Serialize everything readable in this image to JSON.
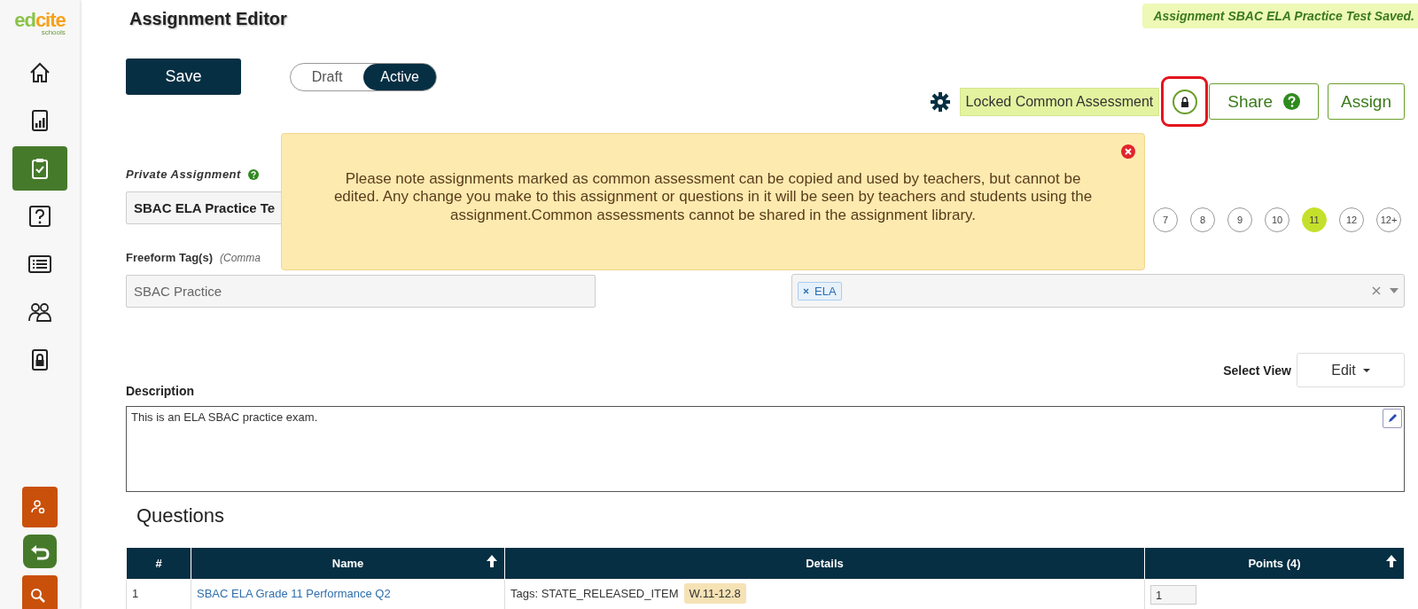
{
  "logo": {
    "brand": "edcite",
    "sub": "schools"
  },
  "sidebar": {
    "items": [
      {
        "kind": "home",
        "selected": false
      },
      {
        "kind": "reports",
        "selected": false
      },
      {
        "kind": "assignments",
        "selected": true
      },
      {
        "kind": "questions",
        "selected": false
      },
      {
        "kind": "lists",
        "selected": false
      },
      {
        "kind": "people",
        "selected": false
      },
      {
        "kind": "locked",
        "selected": false
      }
    ],
    "bottom": [
      {
        "kind": "user-settings"
      },
      {
        "kind": "back"
      },
      {
        "kind": "search"
      }
    ]
  },
  "title": "Assignment Editor",
  "saved_message": "Assignment SBAC ELA Practice Test Saved.",
  "save_button": "Save",
  "status_toggle": [
    {
      "label": "Draft",
      "selected": false
    },
    {
      "label": "Active",
      "selected": true
    }
  ],
  "toolbar": {
    "locked_label": "Locked Common Assessment",
    "lock_highlighted": true,
    "share": "Share",
    "assign": "Assign"
  },
  "notice": {
    "text": "Please note assignments marked as common assessment can be copied and used by teachers, but cannot be edited. Any change you make to this assignment or questions in it will be seen by teachers and students using the assignment.Common assessments cannot be shared in the assignment library."
  },
  "private_assignment": {
    "label": "Private Assignment",
    "value": "SBAC ELA Practice Te"
  },
  "freeform_tags": {
    "label": "Freeform Tag(s)",
    "hint": "(Comma",
    "value": "SBAC Practice"
  },
  "grades": [
    {
      "label": "7",
      "selected": false
    },
    {
      "label": "8",
      "selected": false
    },
    {
      "label": "9",
      "selected": false
    },
    {
      "label": "10",
      "selected": false
    },
    {
      "label": "11",
      "selected": true
    },
    {
      "label": "12",
      "selected": false
    },
    {
      "label": "12+",
      "selected": false
    }
  ],
  "subjects": {
    "tags": [
      "ELA"
    ]
  },
  "select_view": {
    "label": "Select View",
    "value": "Edit"
  },
  "description": {
    "label": "Description",
    "value": "This is an ELA SBAC practice exam."
  },
  "questions": {
    "title": "Questions",
    "columns": [
      {
        "label": "#",
        "sortable": false
      },
      {
        "label": "Name",
        "sortable": true
      },
      {
        "label": "Details",
        "sortable": false
      },
      {
        "label": "Points (4)",
        "sortable": true
      }
    ],
    "rows": [
      {
        "number": "1",
        "name": "SBAC ELA Grade 11 Performance Q2",
        "tags": "Tags: STATE_RELEASED_ITEM",
        "standard": "W.11-12.8",
        "points": "1"
      }
    ]
  }
}
